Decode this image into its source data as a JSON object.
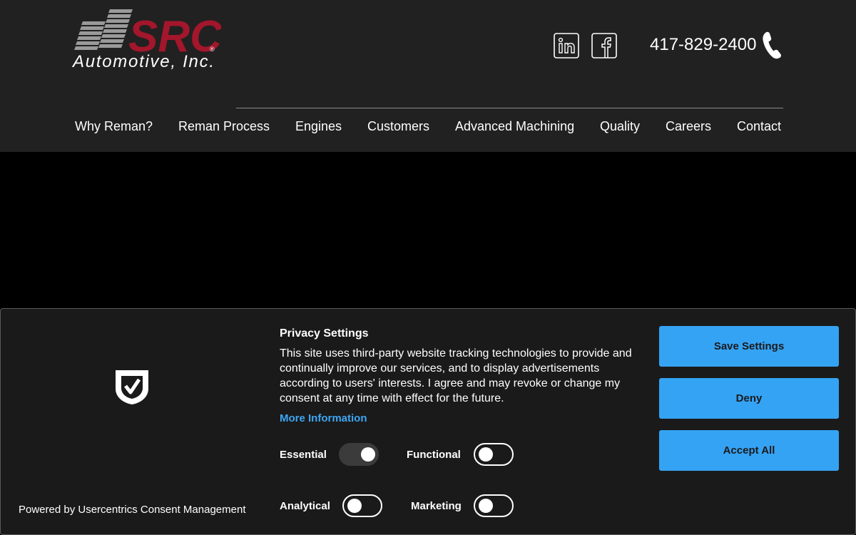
{
  "header": {
    "logo": {
      "brand": "SRC",
      "subtitle": "Automotive, Inc.",
      "registered": "®"
    },
    "social": [
      {
        "name": "linkedin-icon",
        "glyph": "in"
      },
      {
        "name": "facebook-icon",
        "glyph": "f"
      }
    ],
    "phone": "417-829-2400",
    "nav": [
      "Why Reman?",
      "Reman Process",
      "Engines",
      "Customers",
      "Advanced Machining",
      "Quality",
      "Careers",
      "Contact"
    ]
  },
  "consent": {
    "powered_by": "Powered by Usercentrics Consent Management",
    "title": "Privacy Settings",
    "text": "This site uses third-party website tracking technologies to provide and continually improve our services, and to display advertisements according to users' interests. I agree and may revoke or change my consent at any time with effect for the future.",
    "more_info": "More Information",
    "toggles": {
      "essential": {
        "label": "Essential",
        "on": true
      },
      "functional": {
        "label": "Functional",
        "on": false
      },
      "analytical": {
        "label": "Analytical",
        "on": false
      },
      "marketing": {
        "label": "Marketing",
        "on": false
      }
    },
    "buttons": {
      "save": "Save Settings",
      "deny": "Deny",
      "accept": "Accept All"
    }
  },
  "colors": {
    "header_bg": "#212121",
    "page_bg": "#000000",
    "banner_bg": "#1a1a1a",
    "brand_red": "#a3162b",
    "accent_blue": "#35a3f4",
    "link_blue": "#3ea6f3"
  }
}
